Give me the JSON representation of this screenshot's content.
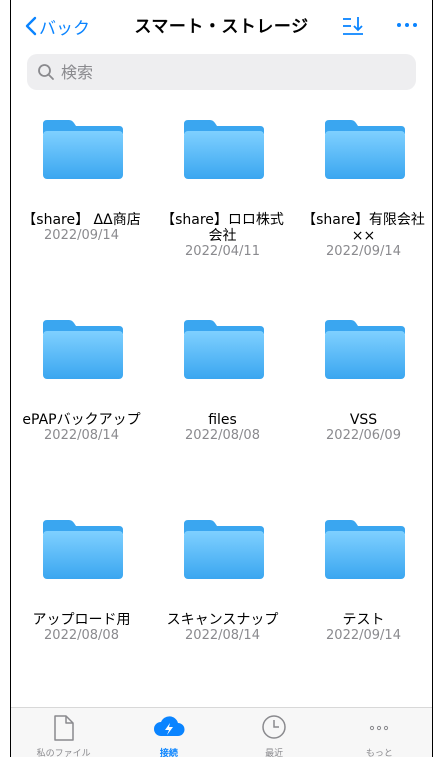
{
  "header": {
    "back_label": "バック",
    "title": "スマート・ストレージ"
  },
  "search": {
    "placeholder": "検索"
  },
  "items": [
    {
      "name": "【share】 ΔΔ商店",
      "date": "2022/09/14"
    },
    {
      "name": "【share】ロロ株式\n会社",
      "date": "2022/04/11"
    },
    {
      "name": "【share】有限会社\n××",
      "date": "2022/09/14"
    },
    {
      "name": "ePAPバックアップ",
      "date": "2022/08/14"
    },
    {
      "name": "files",
      "date": "2022/08/08"
    },
    {
      "name": "VSS",
      "date": "2022/06/09"
    },
    {
      "name": "アップロード用",
      "date": "2022/08/08"
    },
    {
      "name": "スキャンスナップ",
      "date": "2022/08/14"
    },
    {
      "name": "テスト",
      "date": "2022/09/14"
    }
  ],
  "tabbar": {
    "tabs": [
      {
        "label": "私のファイル",
        "icon": "document-icon",
        "active": false
      },
      {
        "label": "接続",
        "icon": "cloud-bolt-icon",
        "active": true
      },
      {
        "label": "最近",
        "icon": "clock-icon",
        "active": false
      },
      {
        "label": "もっと",
        "icon": "more-dots-icon",
        "active": false
      }
    ]
  },
  "colors": {
    "accent": "#0a84ff",
    "folder_light": "#7fd0ff",
    "folder_dark": "#3aa6f0",
    "secondary_text": "#8a8a8e"
  }
}
